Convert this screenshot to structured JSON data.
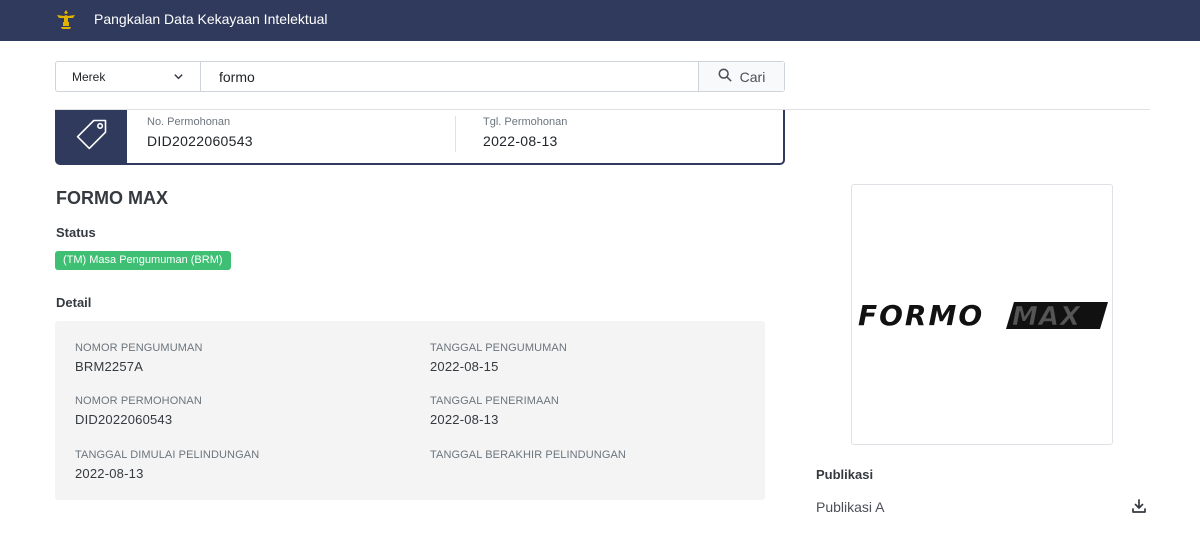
{
  "header": {
    "app_title": "Pangkalan Data Kekayaan Intelektual",
    "bg_color": "#2f3a5c"
  },
  "search": {
    "type_selected": "Merek",
    "query": "formo",
    "button_label": "Cari"
  },
  "summary": {
    "application_number_label": "No. Permohonan",
    "application_number": "DID2022060543",
    "application_date_label": "Tgl. Permohonan",
    "application_date": "2022-08-13",
    "icon": "tag-icon"
  },
  "mark": {
    "title": "FORMO MAX",
    "status_label": "Status",
    "status_badge": "(TM) Masa Pengumuman (BRM)",
    "status_color": "#3fbf73",
    "logo_text_1": "FORMO",
    "logo_text_2": "MAX"
  },
  "detail": {
    "label": "Detail",
    "items": [
      {
        "key": "NOMOR PENGUMUMAN",
        "value": "BRM2257A"
      },
      {
        "key": "TANGGAL PENGUMUMAN",
        "value": "2022-08-15"
      },
      {
        "key": "NOMOR PERMOHONAN",
        "value": "DID2022060543"
      },
      {
        "key": "TANGGAL PENERIMAAN",
        "value": "2022-08-13"
      },
      {
        "key": "TANGGAL DIMULAI PELINDUNGAN",
        "value": "2022-08-13"
      },
      {
        "key": "TANGGAL BERAKHIR PELINDUNGAN",
        "value": ""
      }
    ]
  },
  "publication": {
    "title": "Publikasi",
    "items": [
      {
        "label": "Publikasi A",
        "icon": "download-icon"
      }
    ]
  }
}
